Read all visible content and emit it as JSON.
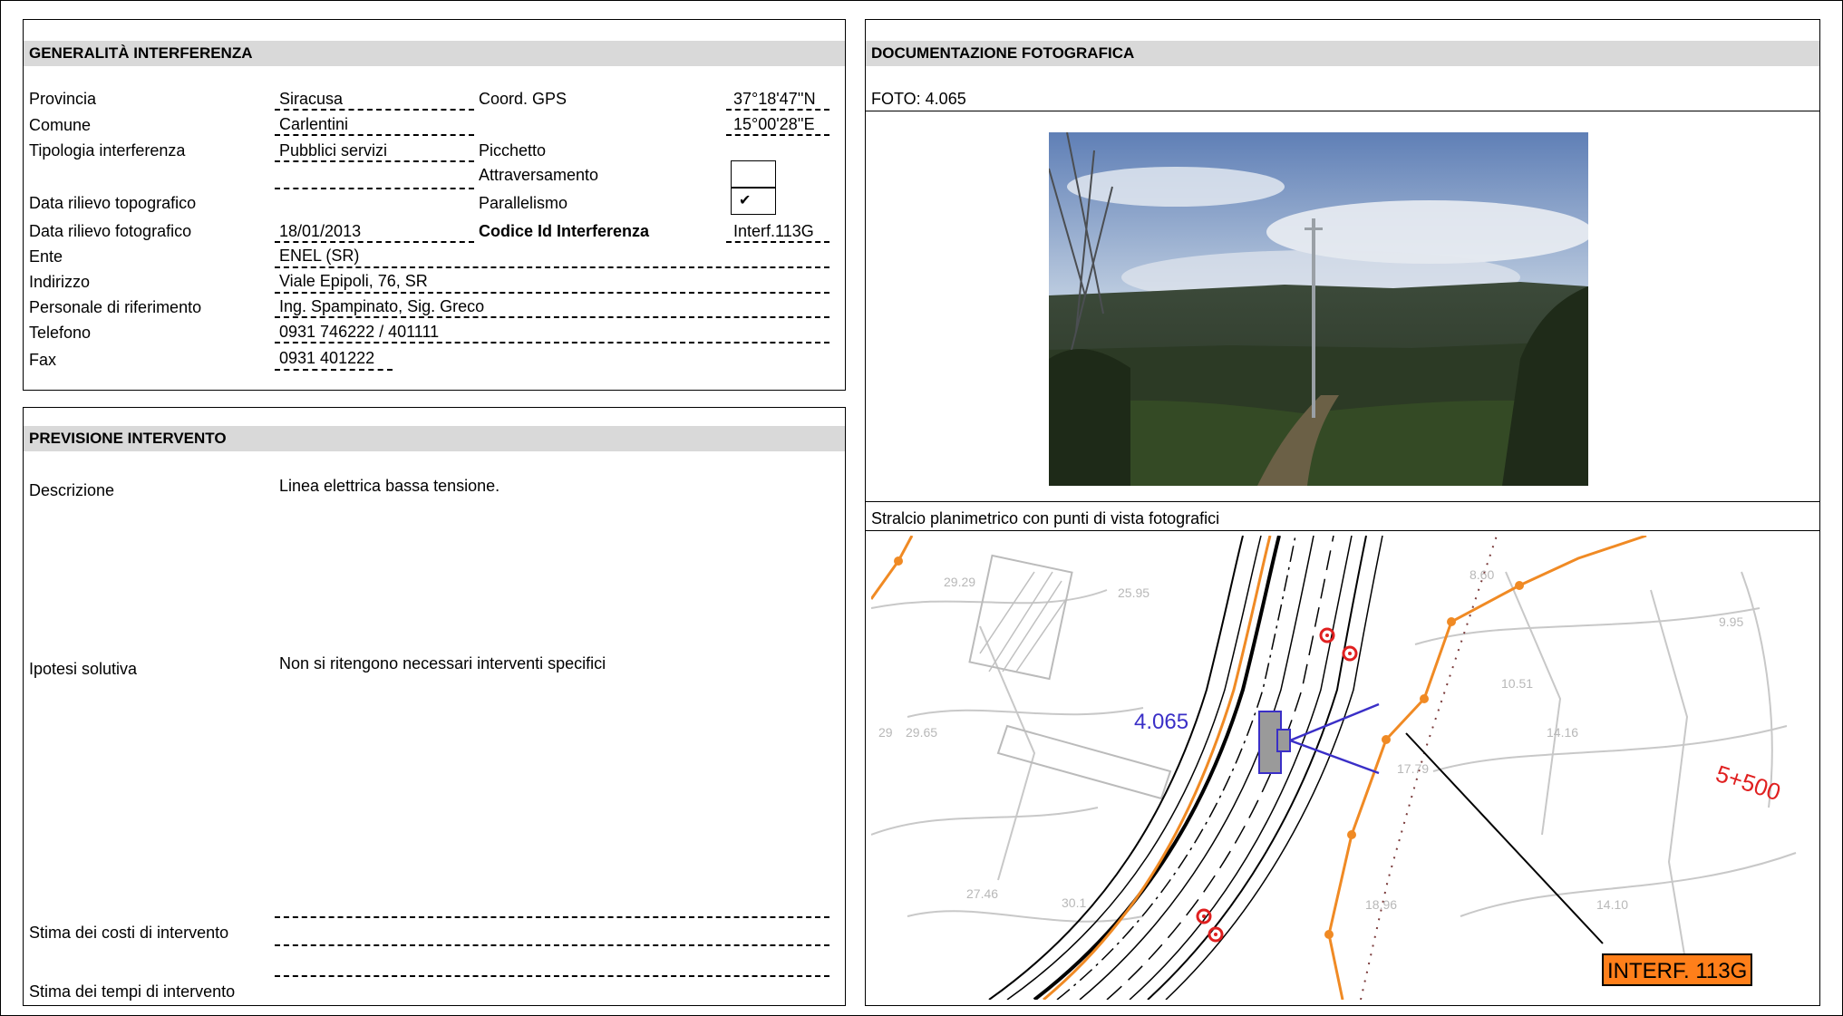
{
  "generalita": {
    "header": "GENERALITÀ  INTERFERENZA",
    "labels": {
      "provincia": "Provincia",
      "comune": "Comune",
      "tipologia": "Tipologia interferenza",
      "data_topo": "Data rilievo topografico",
      "data_foto": "Data rilievo fotografico",
      "ente": "Ente",
      "indirizzo": "Indirizzo",
      "personale": "Personale di riferimento",
      "telefono": "Telefono",
      "fax": "Fax",
      "coord": "Coord. GPS",
      "picchetto": "Picchetto",
      "attraversamento": "Attraversamento",
      "parallelismo": "Parallelismo",
      "codice": "Codice Id Interferenza"
    },
    "values": {
      "provincia": "Siracusa",
      "comune": "Carlentini",
      "tipologia": "Pubblici servizi",
      "data_topo": "",
      "data_foto": "18/01/2013",
      "ente": "ENEL (SR)",
      "indirizzo": "Viale Epipoli, 76, SR",
      "personale": "Ing. Spampinato, Sig. Greco",
      "telefono": "0931 746222 / 401111",
      "fax": "0931 401222",
      "lat": "37°18'47''N",
      "lon": "15°00'28''E",
      "attraversamento_mark": "",
      "parallelismo_mark": "✔",
      "codice": "Interf.113G"
    }
  },
  "previsione": {
    "header": "PREVISIONE INTERVENTO",
    "descrizione_label": "Descrizione",
    "descrizione_value": "Linea elettrica bassa tensione.",
    "ipotesi_label": "Ipotesi solutiva",
    "ipotesi_value": "Non si ritengono necessari interventi specifici",
    "costi_label": "Stima dei costi di intervento",
    "tempi_label": "Stima dei tempi di intervento"
  },
  "documentazione": {
    "header": "DOCUMENTAZIONE FOTOGRAFICA",
    "foto_label": "FOTO: 4.065",
    "stralcio_label": "Stralcio planimetrico con punti di vista fotografici",
    "map": {
      "photo_point": "4.065",
      "chainage": "5+500",
      "interference_tag": "INTERF. 113G",
      "elevations": [
        "29.29",
        "25.95",
        "29",
        "29.65",
        "27.46",
        "30.1",
        "18.96",
        "17.79",
        "14.16",
        "14.10",
        "9.95",
        "10.51",
        "8.60"
      ]
    }
  },
  "colors": {
    "band": "#d9d9d9",
    "map_orange": "#f08a24",
    "map_blue": "#3a2fc7",
    "map_red": "#e02020",
    "tag_bg": "#ff7f1a"
  }
}
